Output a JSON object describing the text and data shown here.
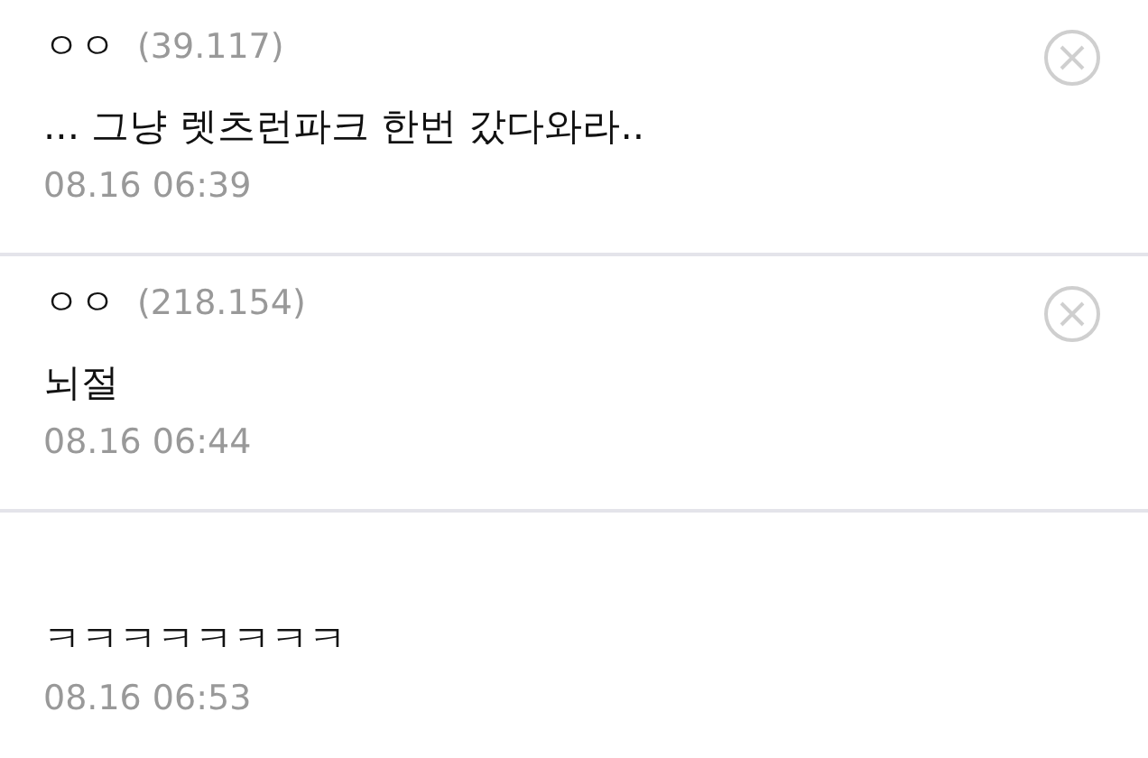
{
  "comments": [
    {
      "author": "ㅇㅇ",
      "ip": "(39.117)",
      "text": "... 그냥 렛츠런파크 한번 갔다와라..",
      "time": "08.16 06:39",
      "deletable": true
    },
    {
      "author": "ㅇㅇ",
      "ip": "(218.154)",
      "text": "뇌절",
      "time": "08.16 06:44",
      "deletable": true
    },
    {
      "text": "ㅋㅋㅋㅋㅋㅋㅋㅋ",
      "time": "08.16 06:53",
      "deletable": false
    }
  ]
}
